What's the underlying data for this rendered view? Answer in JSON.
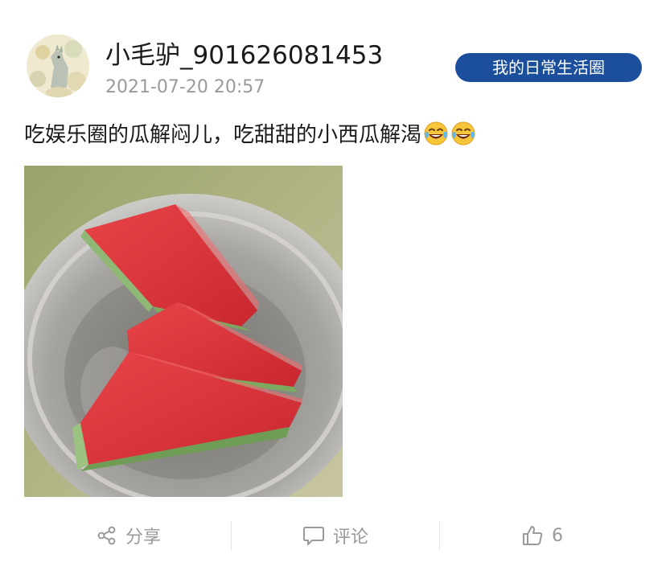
{
  "post": {
    "username": "小毛驴_901626081453",
    "timestamp": "2021-07-20 20:57",
    "circle_tag": "我的日常生活圈",
    "text": "吃娱乐圈的瓜解闷儿，吃甜甜的小西瓜解渴",
    "emojis": [
      "laughing-tears-emoji",
      "laughing-tears-emoji"
    ]
  },
  "actions": {
    "share_label": "分享",
    "comment_label": "评论",
    "like_count": "6"
  },
  "icons": {
    "share": "share-icon",
    "comment": "comment-icon",
    "like": "thumbs-up-icon"
  },
  "colors": {
    "tag_background": "#1b4f9c",
    "tag_text": "#ffffff",
    "muted_text": "#9a9a9a",
    "action_text": "#999999"
  }
}
